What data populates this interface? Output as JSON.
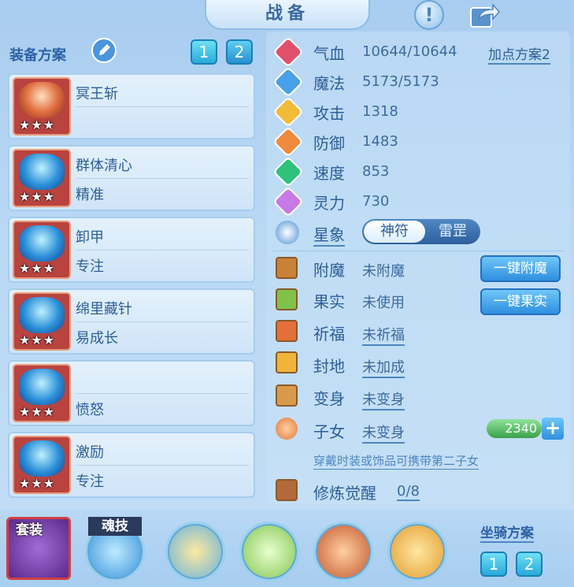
{
  "header": {
    "title": "战备",
    "help_icon": "exclamation-icon",
    "share_icon": "share-arrow-icon"
  },
  "left": {
    "section_label": "装备方案",
    "edit_icon": "pencil-icon",
    "plan_buttons": [
      "1",
      "2"
    ],
    "items": [
      {
        "name": "冥王斩",
        "trait": "",
        "stars": "★★★"
      },
      {
        "name": "群体清心",
        "trait": "精准",
        "stars": "★★★"
      },
      {
        "name": "卸甲",
        "trait": "专注",
        "stars": "★★★"
      },
      {
        "name": "绵里藏针",
        "trait": "易成长",
        "stars": "★★★"
      },
      {
        "name": "",
        "trait": "愤怒",
        "stars": "★★★"
      },
      {
        "name": "激励",
        "trait": "专注",
        "stars": "★★★"
      }
    ]
  },
  "stats": {
    "add_point_plan": "加点方案2",
    "rows": [
      {
        "label": "气血",
        "value": "10644/10644",
        "color": "#e0506a"
      },
      {
        "label": "魔法",
        "value": "5173/5173",
        "color": "#4aa0e8"
      },
      {
        "label": "攻击",
        "value": "1318",
        "color": "#f3bb3a"
      },
      {
        "label": "防御",
        "value": "1483",
        "color": "#f08a3c"
      },
      {
        "label": "速度",
        "value": "853",
        "color": "#2fc27a"
      },
      {
        "label": "灵力",
        "value": "730",
        "color": "#c77ae6"
      }
    ],
    "astro_label": "星象",
    "toggle_on": "神符",
    "toggle_off": "雷罡"
  },
  "attrs": {
    "rows": [
      {
        "label": "附魔",
        "value": "未附魔",
        "button": "一键附魔"
      },
      {
        "label": "果实",
        "value": "未使用",
        "button": "一键果实"
      },
      {
        "label": "祈福",
        "value": "未祈福"
      },
      {
        "label": "封地",
        "value": "未加成"
      },
      {
        "label": "变身",
        "value": "未变身"
      },
      {
        "label": "子女",
        "value": "未变身"
      }
    ],
    "child_points": "2340",
    "plus_icon": "plus-icon",
    "hint": "穿戴时装或饰品可携带第二子女",
    "awaken_label": "修炼觉醒",
    "awaken_value": "0/8"
  },
  "bottom": {
    "set_label": "套装",
    "soul_label": "魂技",
    "mount_label": "坐骑方案",
    "mount_buttons": [
      "1",
      "2"
    ]
  }
}
